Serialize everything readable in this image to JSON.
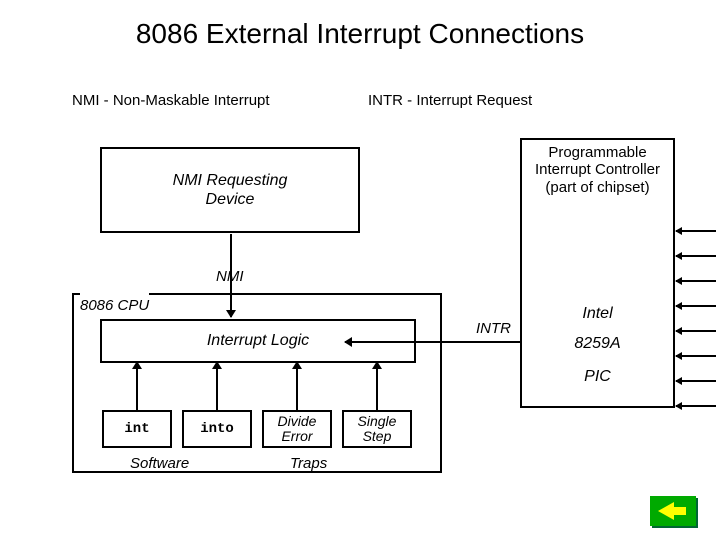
{
  "title": "8086 External Interrupt Connections",
  "defs": {
    "nmi": "NMI -  Non-Maskable Interrupt",
    "intr": "INTR - Interrupt Request"
  },
  "boxes": {
    "nmi_device": "NMI Requesting\nDevice",
    "pic": {
      "header": "Programmable Interrupt Controller (part of chipset)",
      "line1": "Intel",
      "line2": "8259A",
      "line3": "PIC"
    },
    "cpu_label": "8086 CPU",
    "logic": "Interrupt Logic",
    "sources": {
      "int": "int",
      "into": "into",
      "divide": "Divide\nError",
      "single": "Single\nStep"
    }
  },
  "labels": {
    "nmi_line": "NMI",
    "intr_line": "INTR",
    "software": "Software",
    "traps": "Traps"
  },
  "pic_irq_count": 8
}
